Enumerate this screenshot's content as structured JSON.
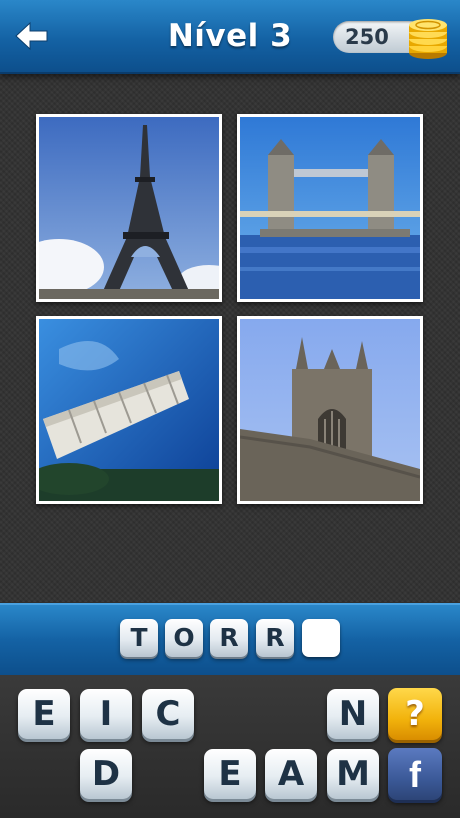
{
  "header": {
    "title": "Nível 3",
    "coins": "250"
  },
  "photos": [
    {
      "name": "photo-eiffel-tower",
      "subject": "Eiffel Tower"
    },
    {
      "name": "photo-tower-bridge",
      "subject": "Tower Bridge"
    },
    {
      "name": "photo-leaning-tower-pisa",
      "subject": "Leaning Tower of Pisa"
    },
    {
      "name": "photo-gothic-church-tower",
      "subject": "Gothic church tower"
    }
  ],
  "answer": {
    "letters": [
      "T",
      "O",
      "R",
      "R",
      ""
    ]
  },
  "letter_tiles": {
    "row1": [
      "E",
      "I",
      "C",
      "N"
    ],
    "row2": [
      "D",
      "E",
      "A",
      "M"
    ]
  },
  "buttons": {
    "hint_label": "?",
    "facebook_label": "f"
  },
  "colors": {
    "header_blue": "#1462a4",
    "hint_yellow": "#f2b30c",
    "facebook_blue": "#3b5998"
  },
  "icons": {
    "back": "arrow-left-icon",
    "coins": "coin-stack-icon"
  }
}
